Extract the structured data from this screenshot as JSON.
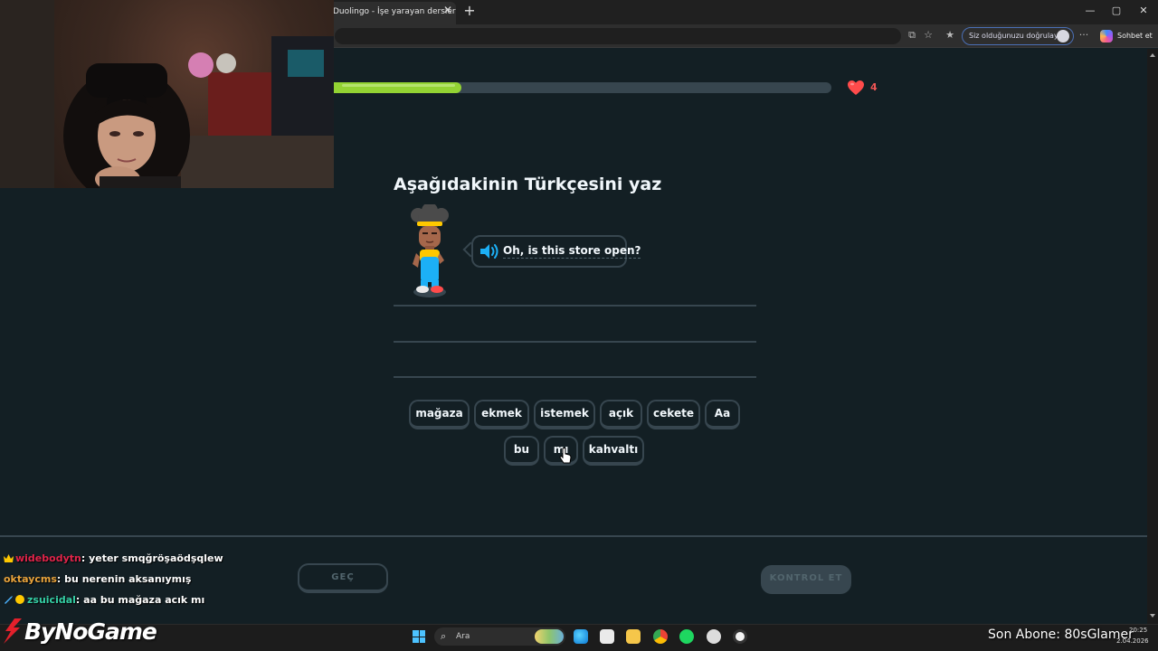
{
  "browser": {
    "tab_title": "Duolingo - İşe yarayan derslerle İn",
    "tab_close": "✕",
    "new_tab": "+",
    "window_controls": {
      "minimize": "—",
      "maximize": "▢",
      "close": "✕"
    },
    "verify_label": "Siz olduğunuzu doğrulayın",
    "copilot_label": "Sohbet et",
    "more_menu": "···"
  },
  "lesson": {
    "progress_fraction": 0.257,
    "hearts": "4",
    "heading": "Aşağıdakinin Türkçesini yaz",
    "prompt_sentence": "Oh, is this store open?",
    "word_bank": {
      "row1": [
        "mağaza",
        "ekmek",
        "istemek",
        "açık",
        "cekete",
        "Aa"
      ],
      "row2": [
        "bu",
        "mı",
        "kahvaltı"
      ]
    },
    "skip_label": "GEÇ",
    "check_label": "KONTROL ET"
  },
  "chat": [
    {
      "user": "widebodytn",
      "user_color": "#e0244a",
      "badge": "crown",
      "message": "yeter smqğröşaödşqlew"
    },
    {
      "user": "oktaycms",
      "user_color": "#e8a33c",
      "badge": "",
      "message": "bu nerenin aksanıymış"
    },
    {
      "user": "zsuicidal",
      "user_color": "#35d0a6",
      "badge": "sword-coin",
      "message": "aa bu mağaza acık mı"
    }
  ],
  "taskbar": {
    "search_placeholder": "Ara",
    "icons": [
      "windows-start-icon",
      "search-icon",
      "edge-icon",
      "store-icon",
      "file-explorer-icon",
      "chrome-icon",
      "spotify-icon",
      "steam-icon",
      "obs-icon"
    ],
    "clock_time": "20:25",
    "clock_date": "2.04.2026"
  },
  "overlay": {
    "brand": "ByNoGame",
    "subscriber_label": "Son Abone: 80sGlamer"
  },
  "colors": {
    "background": "#131f24",
    "progress_green": "#93d333",
    "border": "#37464f",
    "heart_red": "#ff4b4b",
    "speaker_blue": "#1cb0f6"
  }
}
